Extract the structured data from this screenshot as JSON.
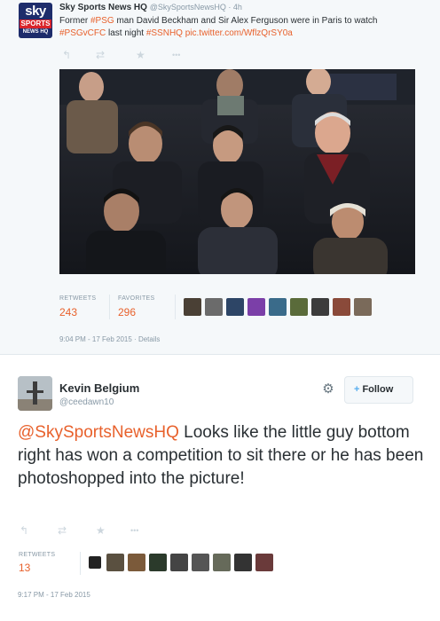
{
  "tweet1": {
    "logo": {
      "sky": "sky",
      "sports": "SPORTS",
      "newshq": "NEWS HQ"
    },
    "author_name": "Sky Sports News HQ",
    "handle_time": "@SkySportsNewsHQ · 4h",
    "text_part1": "Former ",
    "hashtag_psg": "#PSG",
    "text_part2": " man David Beckham and Sir Alex Ferguson were in Paris to watch",
    "hashtag_match": "#PSGvCFC",
    "text_part3": " last night ",
    "hashtag_ssnhq": "#SSNHQ",
    "pic_link": "pic.twitter.com/WflzQrSY0a",
    "actions": {
      "reply": "↰",
      "retweet": "⇄",
      "favorite": "★",
      "more": "•••"
    },
    "stats": {
      "retweets_label": "RETWEETS",
      "retweets_value": "243",
      "favorites_label": "FAVORITES",
      "favorites_value": "296"
    },
    "timestamp": "9:04 PM - 17 Feb 2015 · Details"
  },
  "tweet2": {
    "author_name": "Kevin Belgium",
    "handle": "@ceedawn10",
    "follow_label": "Follow",
    "follow_plus": "+",
    "gear": "⚙",
    "mention": "@SkySportsNewsHQ",
    "text": " Looks like the little guy bottom right has won a competition to sit there or he has been photoshopped into the picture!",
    "actions": {
      "reply": "↰",
      "retweet": "⇄",
      "favorite": "★",
      "more": "•••"
    },
    "stats": {
      "retweets_label": "RETWEETS",
      "retweets_value": "13"
    },
    "timestamp": "9:17 PM - 17 Feb 2015"
  },
  "colors": {
    "accent": "#e8612c",
    "muted": "#8899a6",
    "icon": "#ccd6dd",
    "follow_plus": "#55acee"
  }
}
